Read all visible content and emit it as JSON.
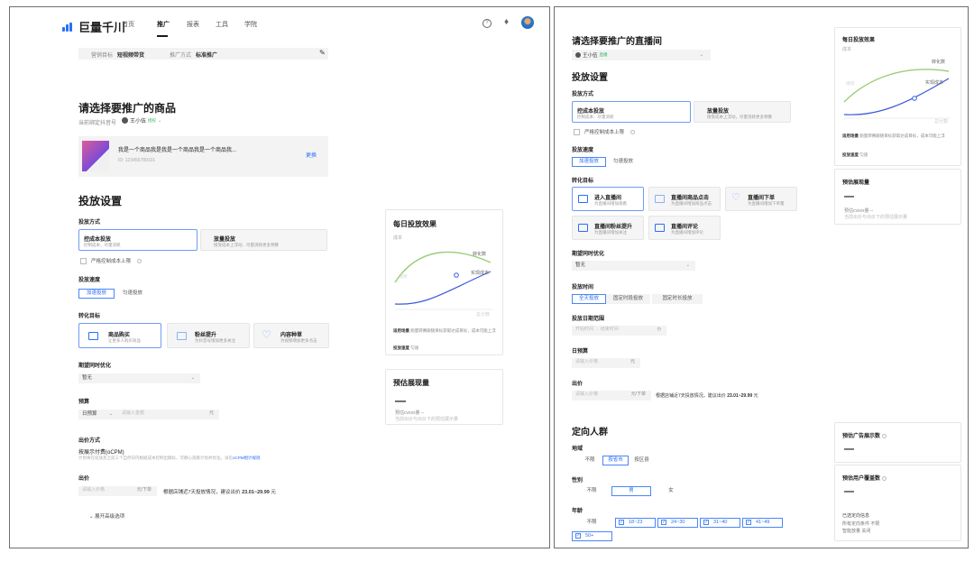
{
  "nav": {
    "logo": "巨量千川",
    "items": [
      "首页",
      "推广",
      "报表",
      "工具",
      "学院"
    ],
    "active": "推广"
  },
  "summary": {
    "goal_label": "营销目标",
    "goal_value": "短视频带货",
    "method_label": "推广方式",
    "method_value": "标准推广"
  },
  "product": {
    "title": "请选择要推广的商品",
    "bind_label": "当前绑定抖音号",
    "account": "王小伍",
    "account_tag": "授权",
    "name": "我是一个商品我是我是一个商品我是一个商品我...",
    "id": "ID: 123456789101",
    "change": "更换"
  },
  "settings": {
    "title": "投放设置",
    "method_label": "投放方式",
    "method_opts": [
      {
        "title": "控成本投放",
        "desc": "控制成本、尽量消耗"
      },
      {
        "title": "放量投放",
        "desc": "接受成本上浮动、尽量消耗更多预算"
      }
    ],
    "strict_cost": "严格控制成本上限",
    "speed_label": "投放速度",
    "speed_opts": [
      "加速投放",
      "匀速投放"
    ],
    "convert_label": "转化目标",
    "convert_opts": [
      {
        "title": "商品购买",
        "desc": "让更多人购买商品"
      },
      {
        "title": "粉丝提升",
        "desc": "为抖音号增加更多关注"
      },
      {
        "title": "内容种草",
        "desc": "为视频增加更多点击"
      }
    ],
    "expect_label": "期望同时优化",
    "expect_value": "暂无",
    "budget_label": "预算",
    "budget_type": "日预算",
    "budget_placeholder": "请输入金额",
    "budget_unit": "元",
    "bid_method_label": "出价方式",
    "bid_method_value": "按展示付费(oCPM)",
    "bid_method_desc": "计划将在投放及之前三个自然日内根据成本控制出稿标，可静心观看计划并优化。详见",
    "bid_method_link": "oCPM相计规则",
    "bid_label": "出价",
    "bid_placeholder": "请输入价格",
    "bid_unit": "元/下单",
    "bid_suggest": "根据店铺近7天投放情况，建议出价",
    "bid_range": "23.01~29.99",
    "bid_suffix": "元",
    "advanced": "展开高级选项"
  },
  "side_daily": {
    "title": "每日投放效果",
    "y_label": "成本",
    "curve_top": "转化数",
    "curve_bottom": "实现成本",
    "x_label": "出价",
    "time_label": "总分数",
    "scene_label": "适用场景",
    "scene_desc": "跑量转赛跟随目标获取达成目标，成本可能上浮",
    "speed_label": "投放速度",
    "speed_value": "匀速"
  },
  "side_exposure": {
    "title": "预估展现量",
    "dash": "—",
    "sub1": "预估cvxxx量  --",
    "sub2": "当前出价与出价下的预估展示量"
  },
  "live": {
    "title": "请选择要推广的直播间",
    "account": "王小伍",
    "account_tag": "直播"
  },
  "live_settings": {
    "title": "投放设置",
    "method_label": "投放方式",
    "method_opts": [
      {
        "title": "控成本投放",
        "desc": "控制成本、尽量消耗"
      },
      {
        "title": "放量投放",
        "desc": "接受成本上浮动，尽量消耗更多预算"
      }
    ],
    "strict_cost": "严格控制成本上限",
    "speed_label": "投放速度",
    "speed_opts": [
      "加速投放",
      "匀速投放"
    ],
    "convert_label": "转化目标",
    "convert_opts": [
      {
        "title": "进入直播间",
        "desc": "为直播间增加观看"
      },
      {
        "title": "直播间商品点击",
        "desc": "为直播间增加商品点击"
      },
      {
        "title": "直播间下单",
        "desc": "为直播间增加下单量"
      },
      {
        "title": "直播间粉丝提升",
        "desc": "为直播间增加关注"
      },
      {
        "title": "直播间评论",
        "desc": "为直播间增加评论"
      }
    ],
    "expect_label": "期望同时优化",
    "expect_value": "暂无",
    "time_label": "投放时间",
    "time_opts": [
      "全天投放",
      "固定时段投放",
      "固定时长投放"
    ],
    "range_label": "投放日期范围",
    "range_start": "开始时间",
    "range_end": "结束时间",
    "budget_label": "日预算",
    "budget_placeholder": "请输入价格",
    "budget_unit": "元",
    "bid_label": "出价",
    "bid_placeholder": "请输入价格",
    "bid_unit": "元/下单",
    "bid_suggest": "根据店铺近7天投放情况，建议出价",
    "bid_range": "23.01~29.99",
    "bid_suffix": "元"
  },
  "targeting": {
    "title": "定向人群",
    "region_label": "地域",
    "region_opts": [
      "不限",
      "按省市",
      "按区县"
    ],
    "gender_label": "性别",
    "gender_opts": [
      "不限",
      "男",
      "女"
    ],
    "age_label": "年龄",
    "age_opts": [
      "不限",
      "18~23",
      "24~30",
      "31~40",
      "41~49",
      "50+"
    ]
  },
  "right_daily": {
    "title": "每日投放效果",
    "y_label": "成本",
    "curve_top": "转化数",
    "curve_bottom": "实现成本",
    "x_label": "出价",
    "time_label": "总分数",
    "scene_label": "适用场景",
    "scene_desc": "跑量转赛跟随目标获取达成目标，成本可能上浮",
    "speed_label": "投放速度",
    "speed_value": "匀速"
  },
  "right_exposure": {
    "title": "预估展现量",
    "dash": "—",
    "sub1": "预估cvxxx量  --",
    "sub2": "当前出价与出价下的预估展示量"
  },
  "ad_count": {
    "title": "预估广告展示数",
    "dash": "—"
  },
  "user_cover": {
    "title": "预估用户覆盖数",
    "dash": "—",
    "sel_title": "已选定向信息",
    "sel_line1": "所有定向条件  不限",
    "sel_line2": "智能放量  关闭"
  }
}
